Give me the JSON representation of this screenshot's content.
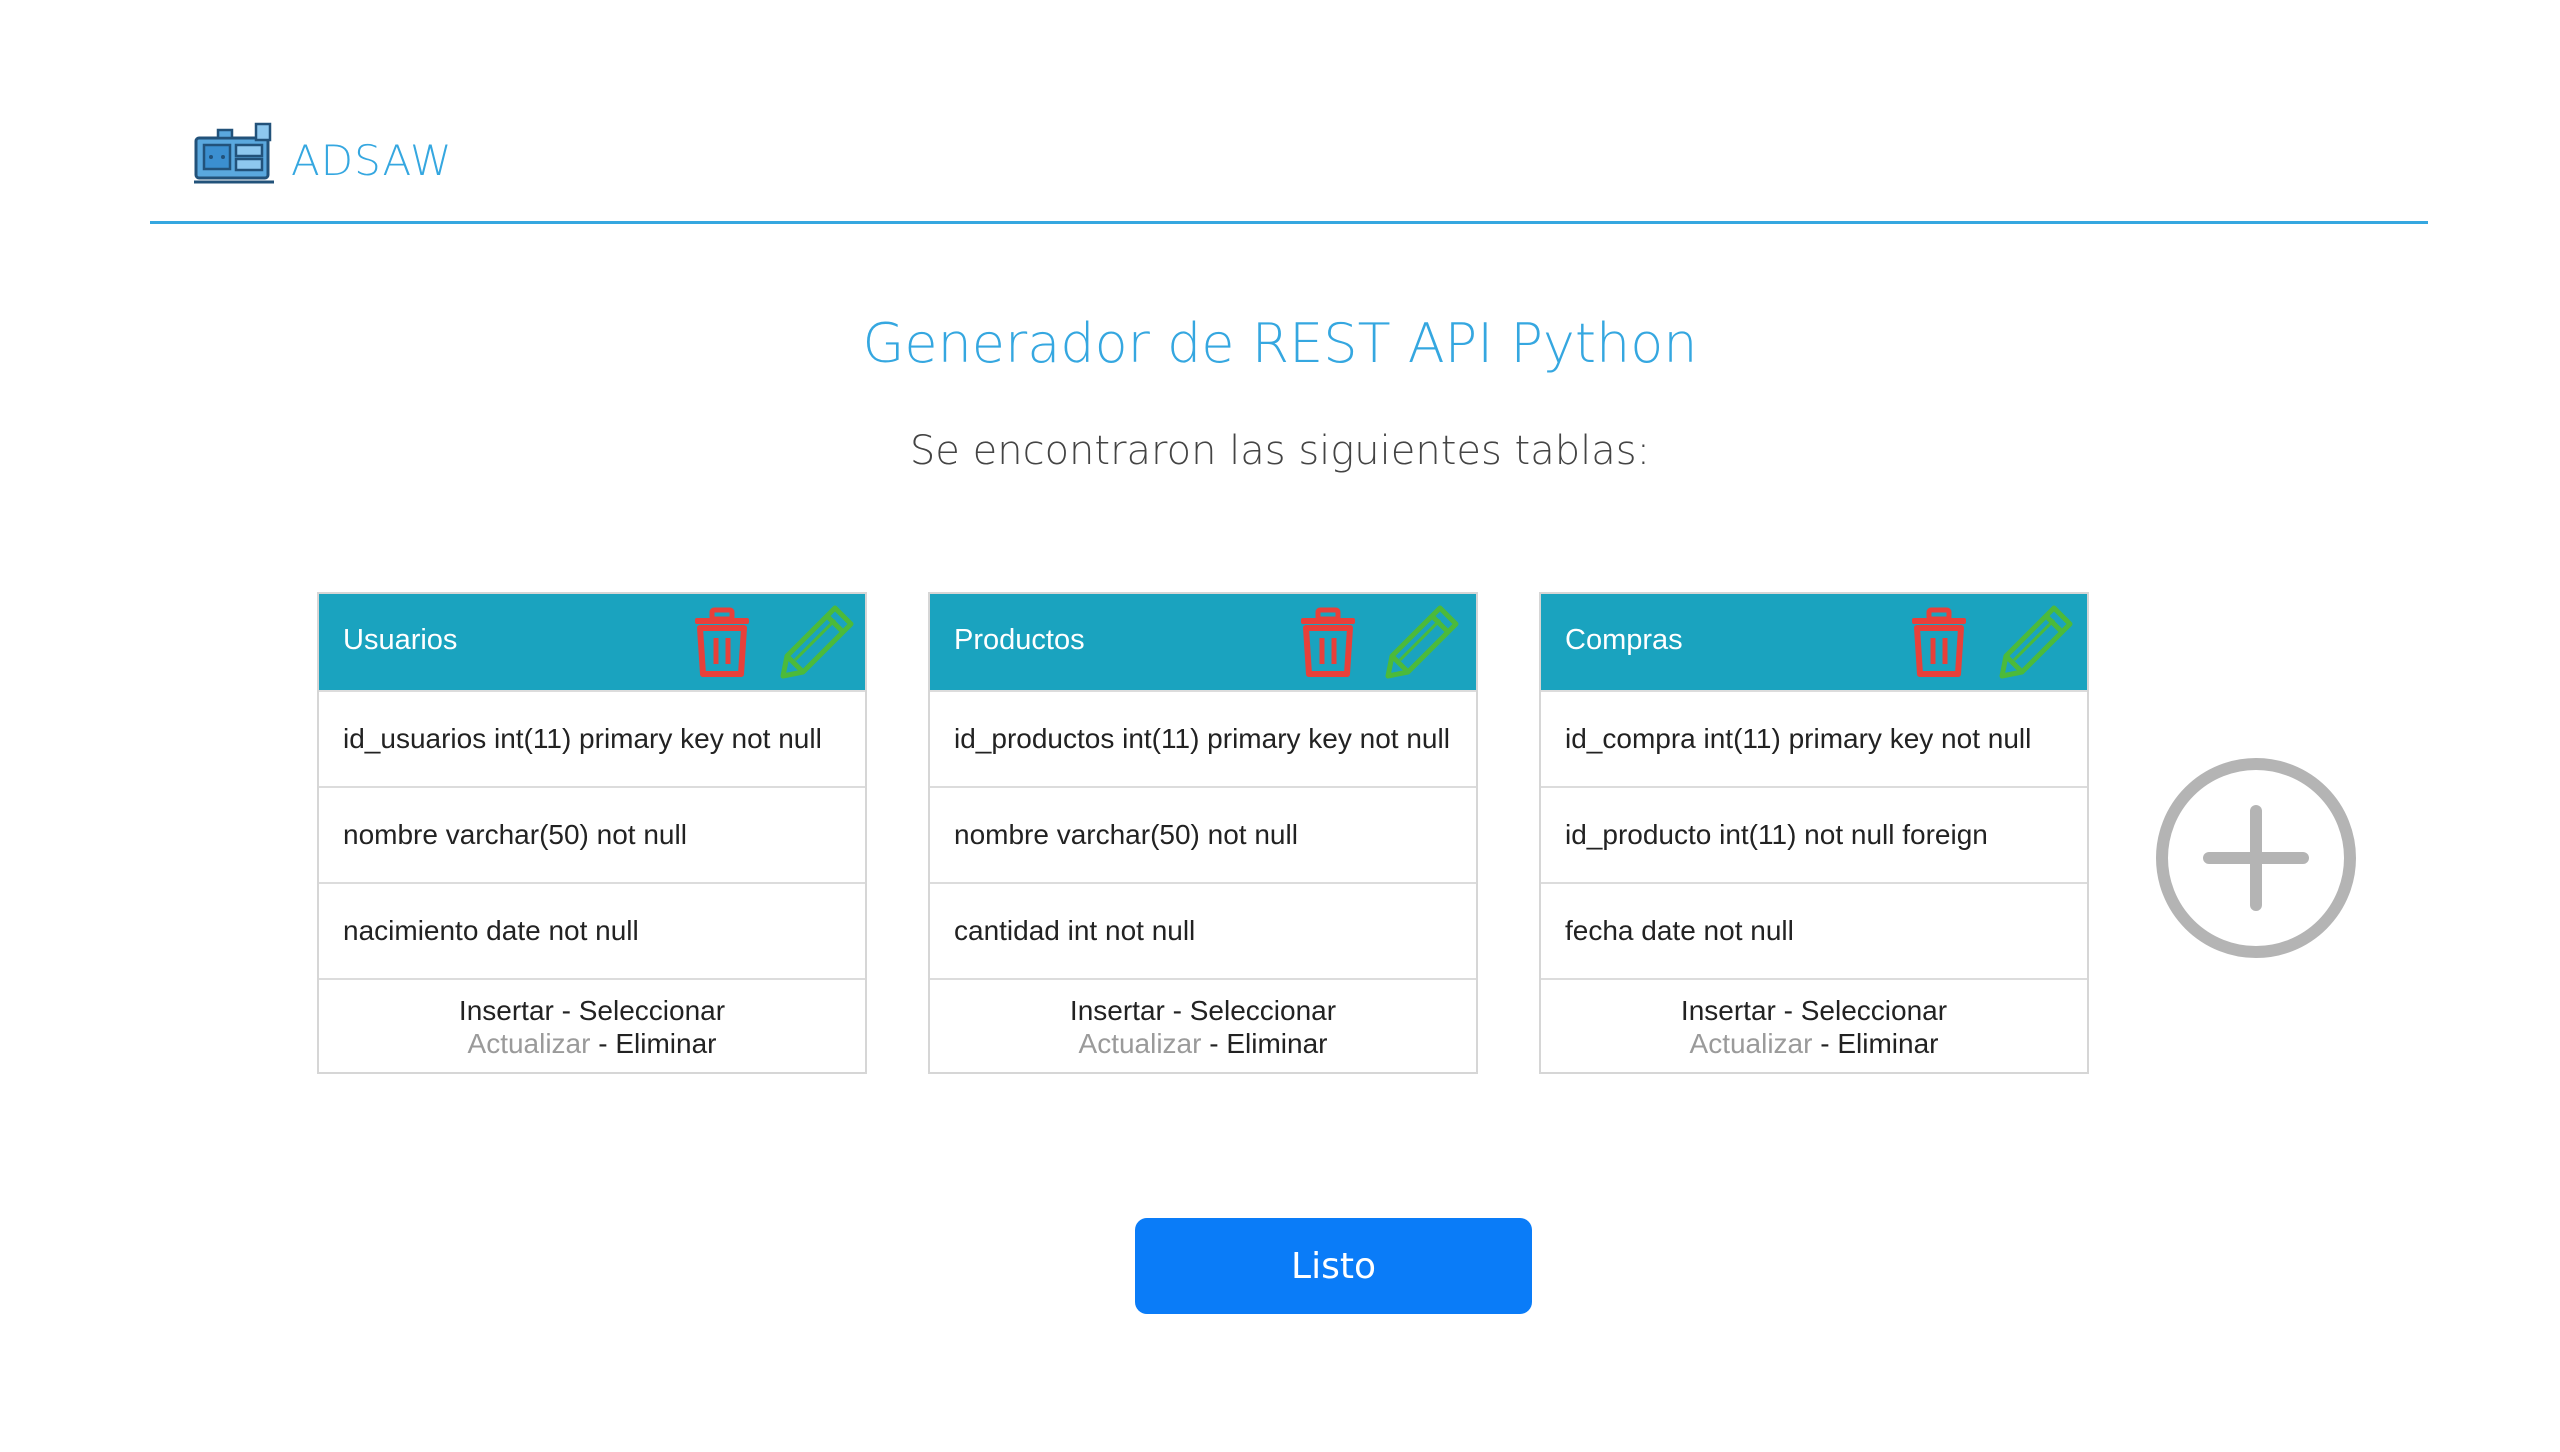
{
  "app": {
    "logo_icon": "server-machine-icon",
    "name": "ADSAW"
  },
  "main": {
    "title": "Generador de REST API Python",
    "subtitle": "Se encontraron las siguientes tablas:"
  },
  "tables": [
    {
      "name": "Usuarios",
      "fields": [
        "id_usuarios int(11) primary key not null",
        "nombre varchar(50) not null",
        "nacimiento date not null"
      ],
      "actions": {
        "insert": "Insertar",
        "select": "Seleccionar",
        "update": "Actualizar",
        "delete": "Eliminar",
        "separator": " - "
      }
    },
    {
      "name": "Productos",
      "fields": [
        "id_productos int(11) primary key not null",
        "nombre varchar(50) not null",
        "cantidad int not null"
      ],
      "actions": {
        "insert": "Insertar",
        "select": "Seleccionar",
        "update": "Actualizar",
        "delete": "Eliminar",
        "separator": " - "
      }
    },
    {
      "name": "Compras",
      "fields": [
        "id_compra int(11) primary key not null",
        "id_producto int(11) not null foreign",
        "fecha date not null"
      ],
      "actions": {
        "insert": "Insertar",
        "select": "Seleccionar",
        "update": "Actualizar",
        "delete": "Eliminar",
        "separator": " - "
      }
    }
  ],
  "icons": {
    "delete": "trash-icon",
    "edit": "pencil-icon",
    "add": "plus-circle-icon"
  },
  "colors": {
    "accent": "#35a7e0",
    "card_header": "#1aa3bf",
    "delete_icon": "#e8403a",
    "edit_icon": "#4cba3a",
    "add_icon": "#b4b4b4",
    "primary_button": "#0a7cf8",
    "disabled_action": "#9a9a9a"
  },
  "footer": {
    "done_label": "Listo"
  }
}
